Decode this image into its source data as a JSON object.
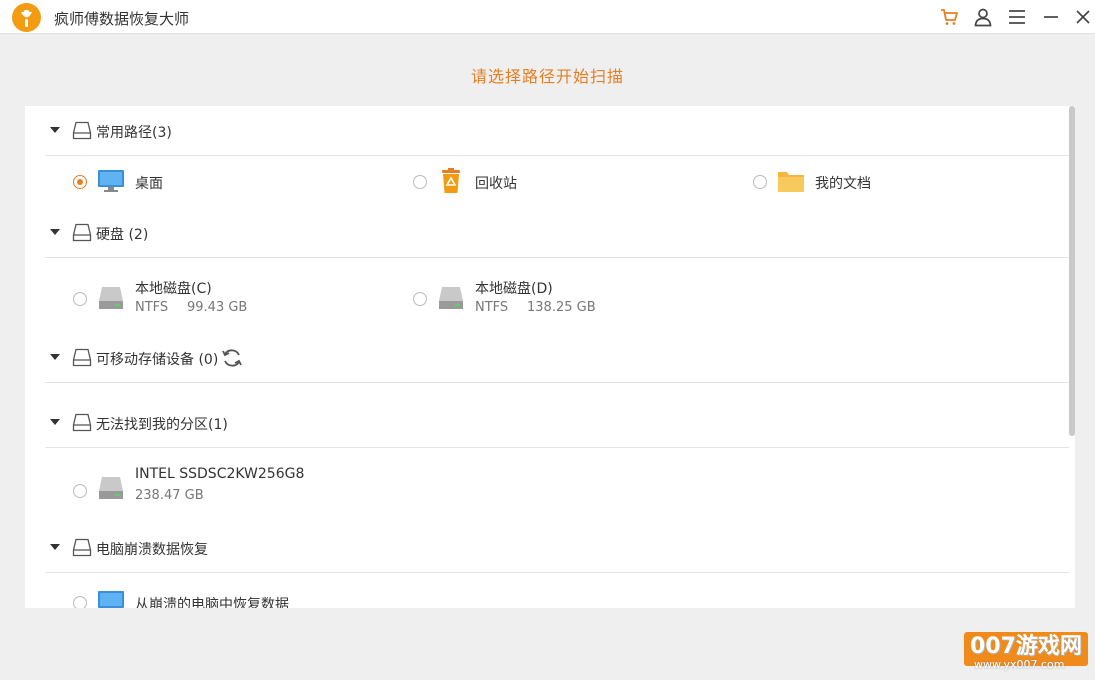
{
  "app": {
    "title": "疯师傅数据恢复大师"
  },
  "heading": "请选择路径开始扫描",
  "sections": {
    "common": {
      "title": "常用路径(3)",
      "items": [
        {
          "label": "桌面",
          "icon": "desktop-monitor-icon",
          "selected": true
        },
        {
          "label": "回收站",
          "icon": "recycle-bin-icon",
          "selected": false
        },
        {
          "label": "我的文档",
          "icon": "folder-icon",
          "selected": false
        }
      ]
    },
    "disks": {
      "title": "硬盘 (2)",
      "items": [
        {
          "name": "本地磁盘(C)",
          "fs": "NTFS",
          "size": "99.43 GB",
          "icon": "hard-drive-icon"
        },
        {
          "name": "本地磁盘(D)",
          "fs": "NTFS",
          "size": "138.25 GB",
          "icon": "hard-drive-icon"
        }
      ]
    },
    "removable": {
      "title": "可移动存储设备 (0)",
      "refresh_icon": "refresh-icon"
    },
    "lost_partition": {
      "title": "无法找到我的分区(1)",
      "items": [
        {
          "name": "INTEL SSDSC2KW256G8",
          "size": "238.47 GB",
          "icon": "hard-drive-icon"
        }
      ]
    },
    "crash": {
      "title": "电脑崩溃数据恢复",
      "items": [
        {
          "label": "从崩溃的电脑中恢复数据",
          "icon": "desktop-monitor-icon"
        }
      ]
    }
  },
  "watermark": {
    "text": "007游戏网",
    "url": "www.yx007.com"
  },
  "colors": {
    "accent": "#e67e22",
    "panel": "#ffffff",
    "background": "#efefef"
  }
}
